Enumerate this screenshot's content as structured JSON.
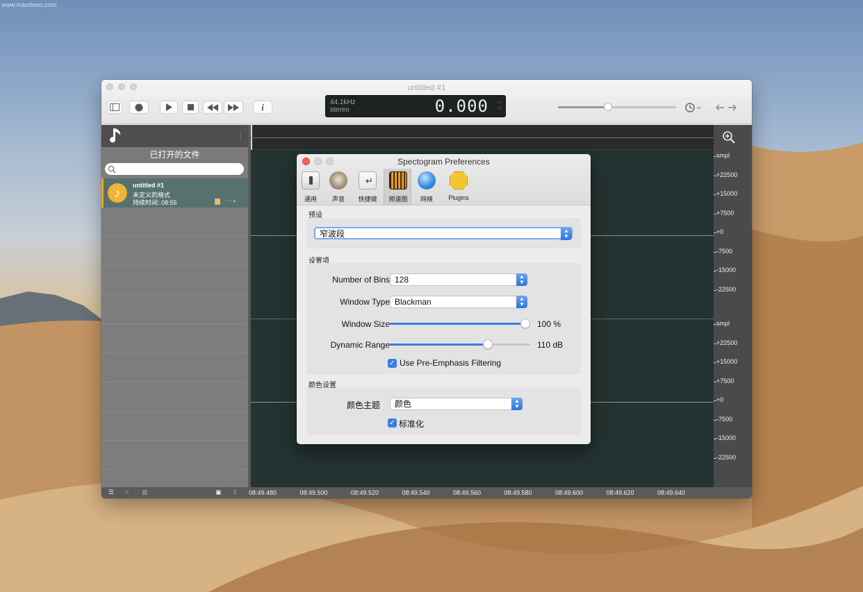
{
  "desktop": {
    "watermark": "www.macdown.com"
  },
  "window": {
    "title": "untitled #1",
    "lcd": {
      "sample_rate": "44.1kHz",
      "channels": "stereo",
      "time": "0.000"
    },
    "volume_level": 0.43
  },
  "sidebar": {
    "title": "已打开的文件",
    "search_placeholder": "",
    "files": [
      {
        "name": "untitled #1",
        "format": "未定义的格式",
        "duration": "持续时间: 08:55"
      }
    ]
  },
  "ruler": {
    "labels_top": [
      "smpl",
      "+22500",
      "+15000",
      "+7500",
      "+0",
      "-7500",
      "-15000",
      "-22500"
    ],
    "labels_bottom": [
      "smpl",
      "+22500",
      "+15000",
      "+7500",
      "+0",
      "-7500",
      "-15000",
      "-22500"
    ]
  },
  "timeline": [
    "08:49.480",
    "08:49.500",
    "08:49.520",
    "08:49.540",
    "08:49.560",
    "08:49.580",
    "08:49.600",
    "08:49.620",
    "08:49.640"
  ],
  "prefs": {
    "title": "Spectogram Preferences",
    "tabs": [
      "通用",
      "声音",
      "快捷键",
      "频谱图",
      "网络",
      "Plugins"
    ],
    "active_tab": "频谱图",
    "preset_section": "预设",
    "preset_value": "窄波段",
    "settings_section": "设置项",
    "bins_label": "Number of Bins",
    "bins_value": "128",
    "window_type_label": "Window Type",
    "window_type_value": "Blackman",
    "window_size_label": "Window Size",
    "window_size_value": "100 %",
    "window_size_level": 1.0,
    "dynamic_range_label": "Dynamic Range",
    "dynamic_range_value": "110 dB",
    "dynamic_range_level": 0.7,
    "pre_emphasis_label": "Use Pre-Emphasis Filtering",
    "pre_emphasis_checked": true,
    "color_section": "颜色设置",
    "color_theme_label": "颜色主题",
    "color_theme_value": "颜色",
    "normalize_label": "标准化",
    "normalize_checked": true
  },
  "colors": {
    "accent": "#3c7ee0",
    "file_selected": "#56716e",
    "wave_bg": "#243331"
  }
}
